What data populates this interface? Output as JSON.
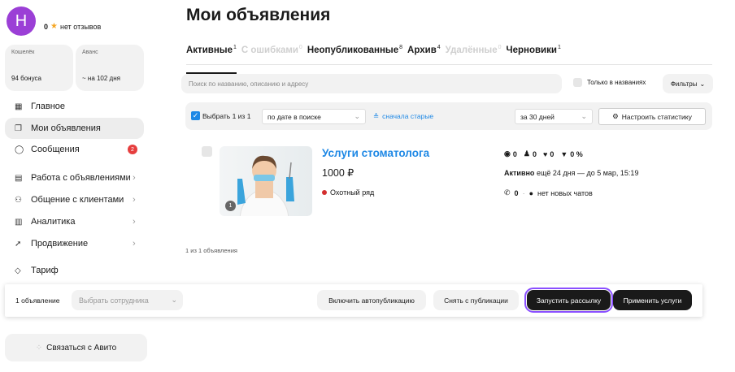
{
  "profile": {
    "initial": "Н",
    "rating": "0",
    "reviews": "нет отзывов"
  },
  "wallet": {
    "caption": "Кошелёк",
    "value": "94 бонуса"
  },
  "advance": {
    "caption": "Аванс",
    "value": "~ на 102 дня"
  },
  "nav": [
    {
      "icon": "grid-icon",
      "glyph": "▦",
      "label": "Главное"
    },
    {
      "icon": "copy-icon",
      "glyph": "❐",
      "label": "Мои объявления"
    },
    {
      "icon": "chat-icon",
      "glyph": "◯",
      "label": "Сообщения",
      "badge": "2"
    },
    {
      "icon": "file-icon",
      "glyph": "▤",
      "label": "Работа с объявлениями"
    },
    {
      "icon": "users-icon",
      "glyph": "⚇",
      "label": "Общение с клиентами"
    },
    {
      "icon": "bars-icon",
      "glyph": "▥",
      "label": "Аналитика"
    },
    {
      "icon": "send-icon",
      "glyph": "➚",
      "label": "Продвижение"
    },
    {
      "icon": "diamond-icon",
      "glyph": "◇",
      "label": "Тариф"
    }
  ],
  "contact_button": "Связаться с Авито",
  "page_title": "Мои объявления",
  "tabs": [
    {
      "label": "Активные",
      "count": "1"
    },
    {
      "label": "С ошибками",
      "count": "0"
    },
    {
      "label": "Неопубликованные",
      "count": "8"
    },
    {
      "label": "Архив",
      "count": "4"
    },
    {
      "label": "Удалённые",
      "count": "0"
    },
    {
      "label": "Черновики",
      "count": "1"
    }
  ],
  "search": {
    "placeholder": "Поиск по названию, описанию и адресу"
  },
  "only_names_label": "Только в названиях",
  "filters_label": "Фильтры",
  "toolbar": {
    "select_text": "Выбрать 1 из 1",
    "sort_value": "по дате в поиске",
    "order_link": "сначала старые",
    "period_value": "за 30 дней",
    "stats_button": "Настроить статистику"
  },
  "listing": {
    "title": "Услуги стоматолога",
    "price": "1000 ₽",
    "location": "Охотный ряд",
    "photo_count": "1",
    "views": "0",
    "contacts": "0",
    "favorites": "0",
    "conversion": "0 %",
    "status": "Активно",
    "status_detail": "ещё 24 дня — до 5 мар, 15:19",
    "calls": "0",
    "chats": "нет новых чатов"
  },
  "count_line": "1 из 1 объявления",
  "bottom_bar": {
    "count": "1 объявление",
    "employee_placeholder": "Выбрать сотрудника",
    "autopublish": "Включить автопубликацию",
    "unpublish": "Снять с публикации",
    "mailing": "Запустить рассылку",
    "apply_services": "Применить услуги"
  },
  "colors": {
    "accent": "#1e88e5",
    "brand_purple": "#9b3fd6",
    "focus": "#8a4fff",
    "badge": "#e63e3e"
  }
}
